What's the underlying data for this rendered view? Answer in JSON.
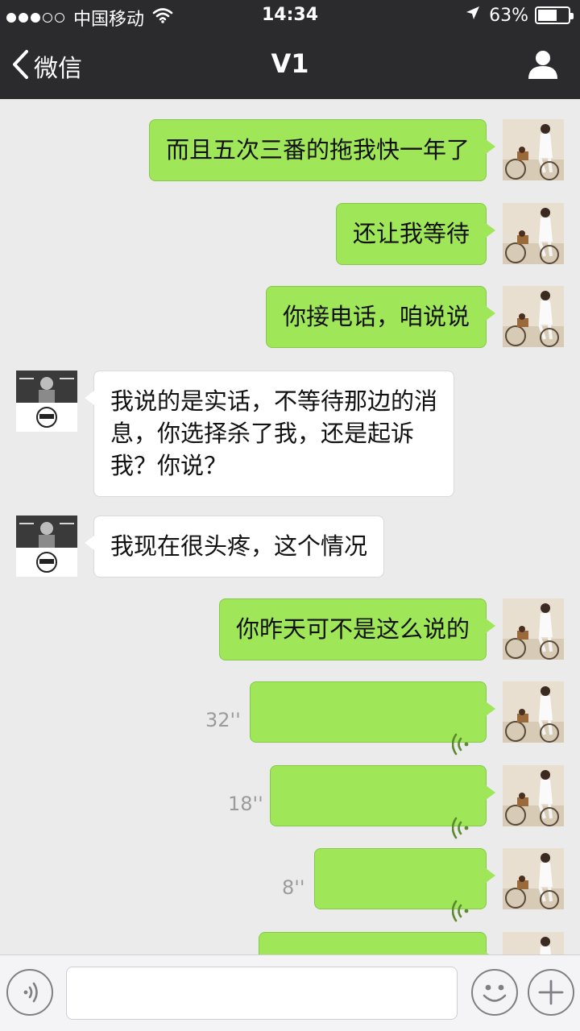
{
  "status_bar": {
    "carrier": "中国移动",
    "time": "14:34",
    "battery": "63%",
    "battery_level": 0.63
  },
  "nav": {
    "back_label": "微信",
    "title": "V1",
    "icons": {
      "back": "chevron-left-icon",
      "profile": "person-icon"
    }
  },
  "messages": [
    {
      "sender": "me",
      "type": "text",
      "text": "而且五次三番的拖我快一年了"
    },
    {
      "sender": "me",
      "type": "text",
      "text": "还让我等待"
    },
    {
      "sender": "me",
      "type": "text",
      "text": "你接电话，咱说说"
    },
    {
      "sender": "other",
      "type": "text",
      "text": "我说的是实话，不等待那边的消\n息，你选择杀了我，还是起诉\n我？你说？"
    },
    {
      "sender": "other",
      "type": "text",
      "text": "我现在很头疼，这个情况"
    },
    {
      "sender": "me",
      "type": "text",
      "text": "你昨天可不是这么说的"
    },
    {
      "sender": "me",
      "type": "voice",
      "duration": "32''"
    },
    {
      "sender": "me",
      "type": "voice",
      "duration": "18''"
    },
    {
      "sender": "me",
      "type": "voice",
      "duration": "8''"
    },
    {
      "sender": "me",
      "type": "voice",
      "duration": ""
    }
  ],
  "input_bar": {
    "text_value": "",
    "icons": {
      "voice": "voice-mode-icon",
      "emoji": "emoji-icon",
      "more": "plus-icon"
    }
  },
  "colors": {
    "header_bg": "#2b2b2e",
    "chat_bg": "#ebebeb",
    "my_bubble": "#9fe658",
    "other_bubble": "#ffffff"
  }
}
